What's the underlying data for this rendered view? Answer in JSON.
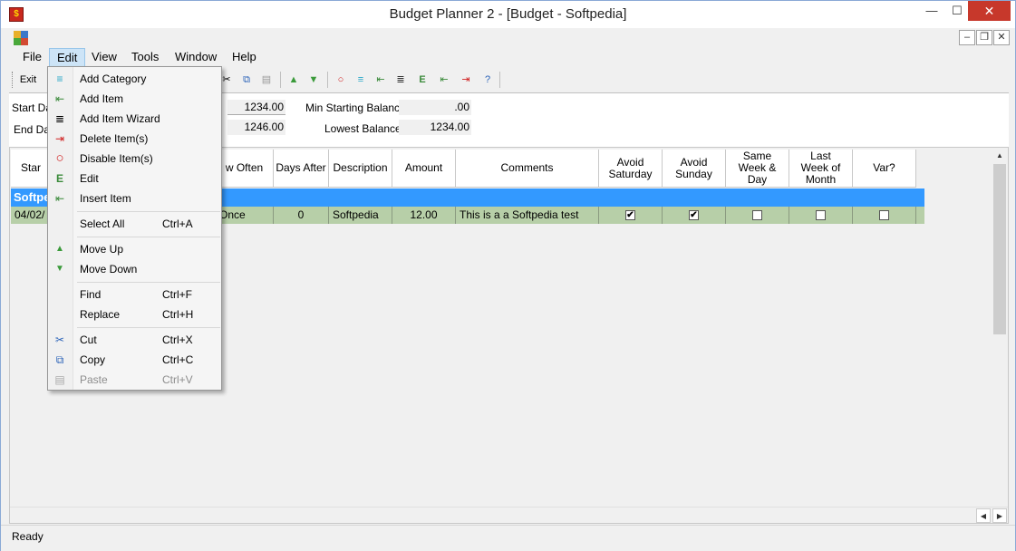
{
  "window": {
    "title": "Budget Planner 2 - [Budget - Softpedia]",
    "min_glyph": "—",
    "max_glyph": "☐",
    "close_glyph": "✕"
  },
  "mdi": {
    "min": "–",
    "restore": "❐",
    "close": "✕"
  },
  "menubar": {
    "file": "File",
    "edit": "Edit",
    "view": "View",
    "tools": "Tools",
    "window": "Window",
    "help": "Help"
  },
  "toolbar": {
    "exit": "Exit"
  },
  "header": {
    "start_date_label": "Start Da",
    "end_date_label": "End Dat",
    "start_balance": "1234.00",
    "end_balance": "1246.00",
    "min_starting_balance_label": "Min Starting Balance",
    "min_starting_balance": ".00",
    "lowest_balance_label": "Lowest Balance",
    "lowest_balance": "1234.00"
  },
  "grid": {
    "columns": [
      "Star",
      "w Often",
      "Days After",
      "Description",
      "Amount",
      "Comments",
      "Avoid Saturday",
      "Avoid Sunday",
      "Same Week & Day",
      "Last Week of Month",
      "Var?"
    ],
    "category": "Softpe",
    "row": {
      "date": "04/02/",
      "how_often": "Once",
      "days_after": "0",
      "description": "Softpedia",
      "amount": "12.00",
      "comments": "This is a a Softpedia test",
      "avoid_saturday": "✔",
      "avoid_sunday": "✔"
    }
  },
  "status": {
    "text": "Ready"
  },
  "edit_menu": {
    "add_category": "Add Category",
    "add_item": "Add Item",
    "add_item_wizard": "Add Item Wizard",
    "delete_items": "Delete Item(s)",
    "disable_items": "Disable Item(s)",
    "edit": "Edit",
    "insert_item": "Insert Item",
    "select_all": "Select All",
    "select_all_shortcut": "Ctrl+A",
    "move_up": "Move Up",
    "move_down": "Move Down",
    "find": "Find",
    "find_shortcut": "Ctrl+F",
    "replace": "Replace",
    "replace_shortcut": "Ctrl+H",
    "cut": "Cut",
    "cut_shortcut": "Ctrl+X",
    "copy": "Copy",
    "copy_shortcut": "Ctrl+C",
    "paste": "Paste",
    "paste_shortcut": "Ctrl+V"
  },
  "colors": {
    "category_row": "#3399ff",
    "data_row": "#b7cfa8",
    "menu_highlight": "#cde4f7",
    "close_button": "#c7382b"
  }
}
